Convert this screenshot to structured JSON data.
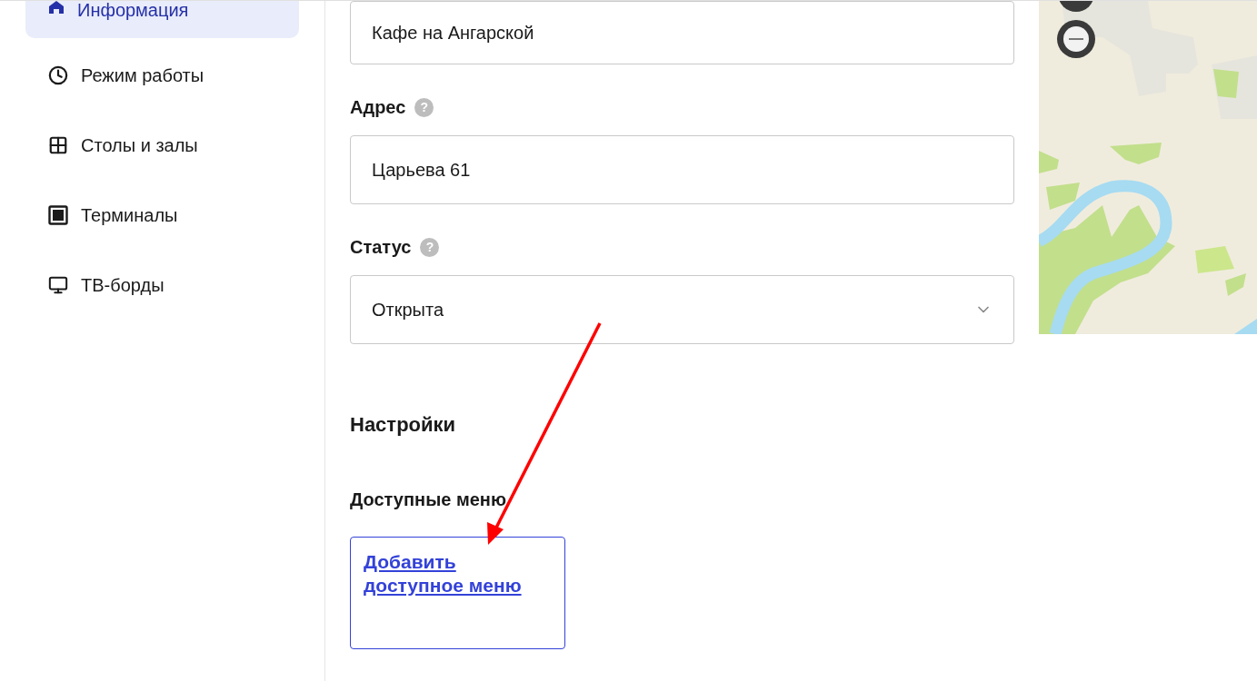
{
  "sidebar": {
    "items": [
      {
        "label": "Информация",
        "selected": true
      },
      {
        "label": "Режим работы",
        "selected": false
      },
      {
        "label": "Столы и залы",
        "selected": false
      },
      {
        "label": "Терминалы",
        "selected": false
      },
      {
        "label": "ТВ-борды",
        "selected": false
      }
    ]
  },
  "form": {
    "fields": [
      {
        "kind": "text",
        "value": "Кафе на Ангарской"
      },
      {
        "kind": "text",
        "label": "Адрес",
        "help": "?",
        "value": "Царьева 61"
      },
      {
        "kind": "select",
        "label": "Статус",
        "help": "?",
        "value": "Открыта"
      }
    ]
  },
  "settings": {
    "title": "Настройки",
    "available_menus": {
      "label": "Доступные меню",
      "add_link": "Добавить доступное меню"
    }
  }
}
